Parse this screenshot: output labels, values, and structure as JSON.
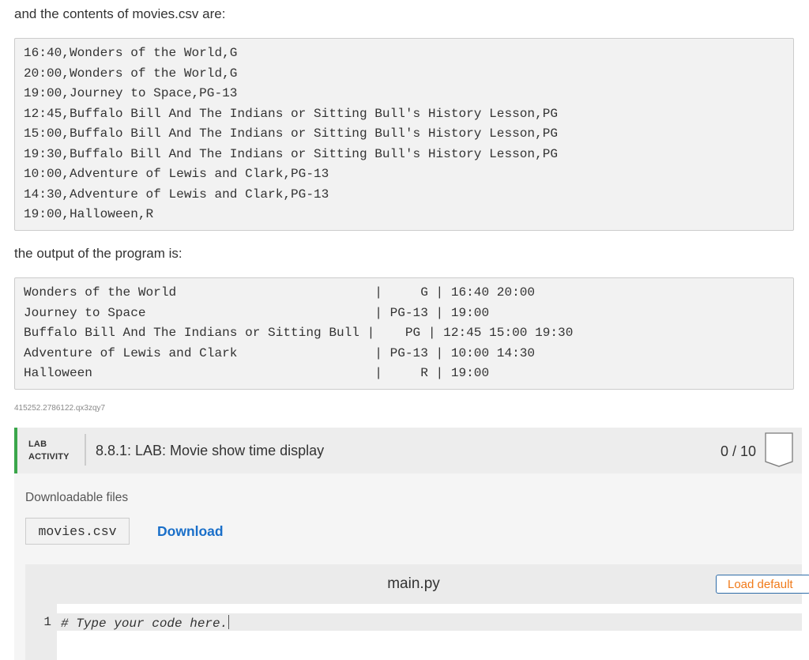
{
  "intro_text": "and the contents of movies.csv are:",
  "csv_lines": [
    "16:40,Wonders of the World,G",
    "20:00,Wonders of the World,G",
    "19:00,Journey to Space,PG-13",
    "12:45,Buffalo Bill And The Indians or Sitting Bull's History Lesson,PG",
    "15:00,Buffalo Bill And The Indians or Sitting Bull's History Lesson,PG",
    "19:30,Buffalo Bill And The Indians or Sitting Bull's History Lesson,PG",
    "10:00,Adventure of Lewis and Clark,PG-13",
    "14:30,Adventure of Lewis and Clark,PG-13",
    "19:00,Halloween,R"
  ],
  "output_intro": "the output of the program is:",
  "output_lines": [
    "Wonders of the World                          |     G | 16:40 20:00",
    "Journey to Space                              | PG-13 | 19:00",
    "Buffalo Bill And The Indians or Sitting Bull |    PG | 12:45 15:00 19:30",
    "Adventure of Lewis and Clark                  | PG-13 | 10:00 14:30",
    "Halloween                                     |     R | 19:00"
  ],
  "code_id": "415252.2786122.qx3zqy7",
  "lab": {
    "type_line1": "LAB",
    "type_line2": "ACTIVITY",
    "title": "8.8.1: LAB: Movie show time display",
    "score": "0 / 10",
    "accent_color": "#3aa64a",
    "downloadable_label": "Downloadable files",
    "file_name": "movies.csv",
    "download_label": "Download",
    "editor": {
      "filename": "main.py",
      "load_default_label": "Load default",
      "line_number": "1",
      "code": "# Type your code here."
    }
  }
}
